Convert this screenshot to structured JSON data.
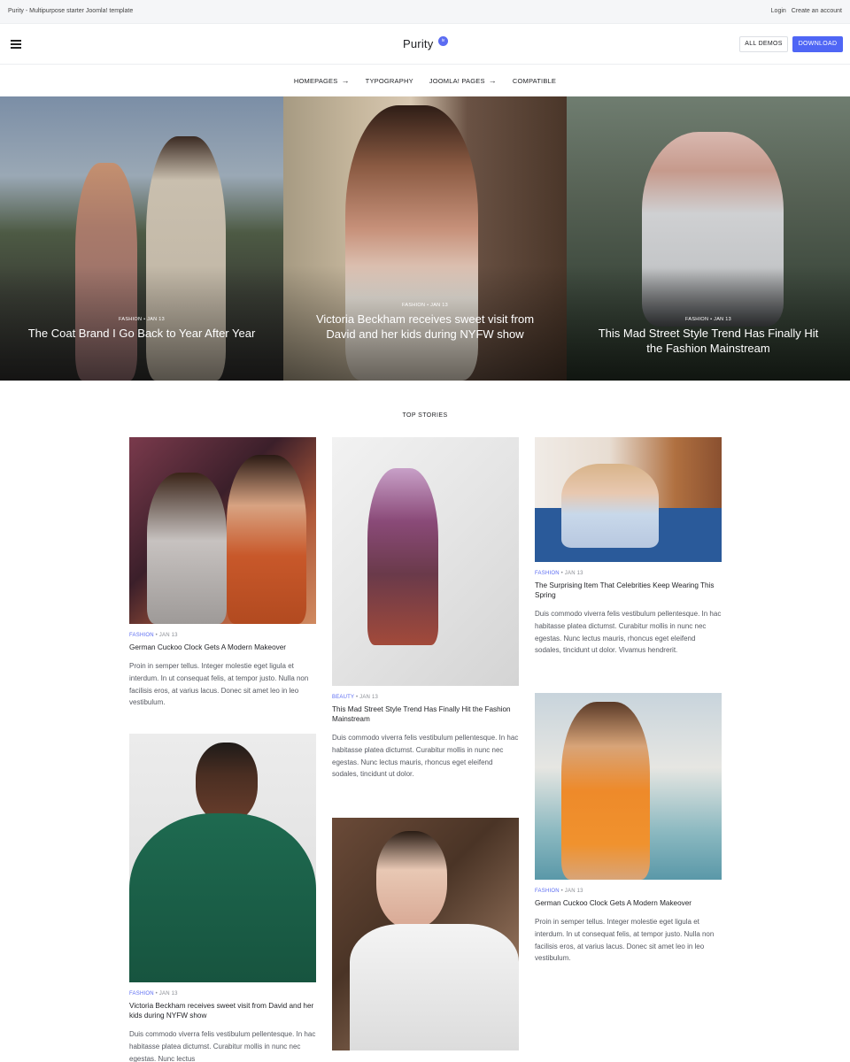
{
  "topbar": {
    "tagline": "Purity - Multipurpose starter Joomla! template",
    "login": "Login",
    "create_account": "Create an account"
  },
  "header": {
    "logo": "Purity",
    "badge": "iv",
    "all_demos": "ALL DEMOS",
    "download": "DOWNLOAD"
  },
  "nav": {
    "items": [
      {
        "label": "HOMEPAGES",
        "arrow": "→"
      },
      {
        "label": "TYPOGRAPHY",
        "arrow": ""
      },
      {
        "label": "JOOMLA! PAGES",
        "arrow": "→"
      },
      {
        "label": "COMPATIBLE",
        "arrow": ""
      }
    ]
  },
  "hero": {
    "slides": [
      {
        "category": "FASHION",
        "date": "JAN 13",
        "title": "The Coat Brand I Go Back to Year After Year"
      },
      {
        "category": "FASHION",
        "date": "JAN 13",
        "title": "Victoria Beckham receives sweet visit from David and her kids during NYFW show"
      },
      {
        "category": "FASHION",
        "date": "JAN 13",
        "title": "This Mad Street Style Trend Has Finally Hit the Fashion Mainstream"
      }
    ]
  },
  "section": {
    "title": "TOP STORIES"
  },
  "cards": [
    {
      "category": "FASHION",
      "date": "JAN 13",
      "title": "German Cuckoo Clock Gets A Modern  Makeover",
      "excerpt": "Proin in semper tellus. Integer molestie eget ligula et interdum. In ut consequat felis, at tempor justo. Nulla non facilisis eros, at varius lacus. Donec sit amet leo in leo vestibulum."
    },
    {
      "category": "BEAUTY",
      "date": "JAN 13",
      "title": "This Mad Street Style Trend Has Finally Hit the Fashion Mainstream",
      "excerpt": "Duis commodo viverra felis vestibulum pellentesque. In hac habitasse platea dictumst. Curabitur mollis in nunc nec egestas. Nunc lectus mauris, rhoncus eget eleifend sodales, tincidunt ut dolor."
    },
    {
      "category": "FASHION",
      "date": "JAN 13",
      "title": "The Surprising Item That Celebrities  Keep Wearing This Spring",
      "excerpt": "Duis commodo viverra felis vestibulum pellentesque. In hac habitasse platea dictumst. Curabitur mollis in nunc nec egestas. Nunc lectus mauris, rhoncus eget eleifend sodales, tincidunt ut dolor. Vivamus hendrerit."
    },
    {
      "category": "FASHION",
      "date": "JAN 13",
      "title": "Victoria Beckham receives sweet visit from David and her kids during NYFW show",
      "excerpt": "Duis commodo viverra felis vestibulum pellentesque. In hac habitasse platea dictumst. Curabitur mollis in nunc nec egestas. Nunc lectus"
    },
    {
      "category": "",
      "date": "",
      "title": "",
      "excerpt": ""
    },
    {
      "category": "FASHION",
      "date": "JAN 13",
      "title": "German Cuckoo Clock Gets A Modern  Makeover",
      "excerpt": "Proin in semper tellus. Integer molestie eget ligula et interdum. In ut consequat felis, at tempor justo. Nulla non facilisis eros, at varius lacus. Donec sit amet leo in leo vestibulum."
    }
  ],
  "meta_separator": " • "
}
